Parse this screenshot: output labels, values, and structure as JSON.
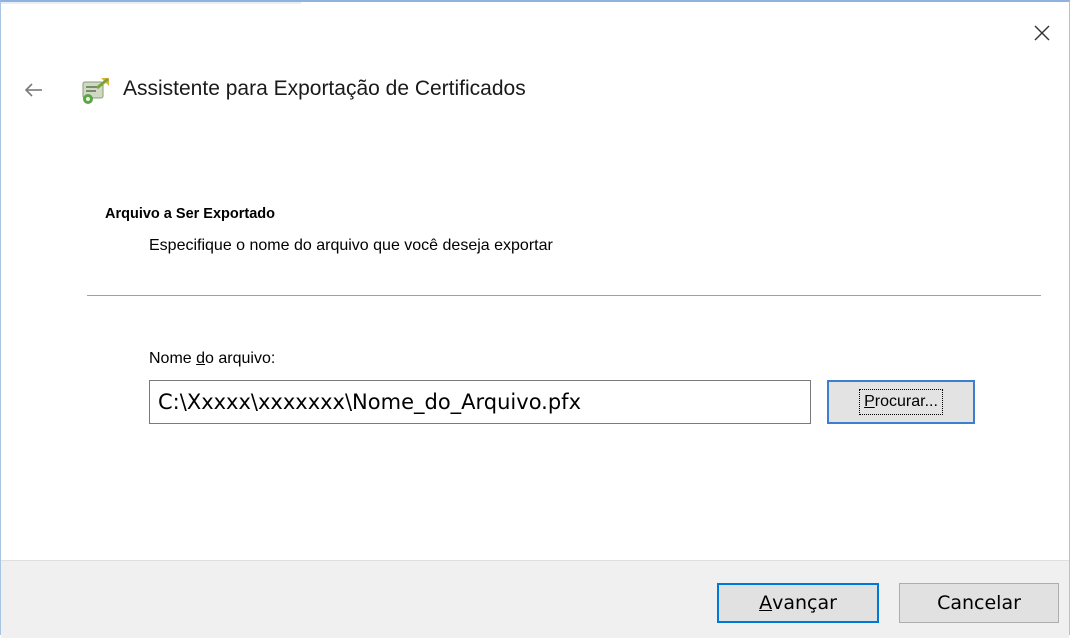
{
  "window": {
    "title": "Assistente para Exportação de Certificados"
  },
  "icons": {
    "close": "close-icon",
    "back": "back-arrow-icon",
    "app": "certificate-wizard-icon"
  },
  "section": {
    "heading": "Arquivo a Ser Exportado",
    "description": "Especifique o nome do arquivo que você deseja exportar"
  },
  "file_field": {
    "label_before": "Nome ",
    "label_accel": "d",
    "label_after": "o arquivo:",
    "value": "C:\\Xxxxx\\xxxxxxx\\Nome_do_Arquivo.pfx"
  },
  "browse_button": {
    "accel": "P",
    "rest": "rocurar..."
  },
  "footer": {
    "next_accel": "A",
    "next_rest": "vançar",
    "cancel_label": "Cancelar"
  },
  "colors": {
    "accent_border": "#0078d7",
    "footer_bg": "#f0f0f0",
    "button_bg": "#e1e1e1"
  }
}
